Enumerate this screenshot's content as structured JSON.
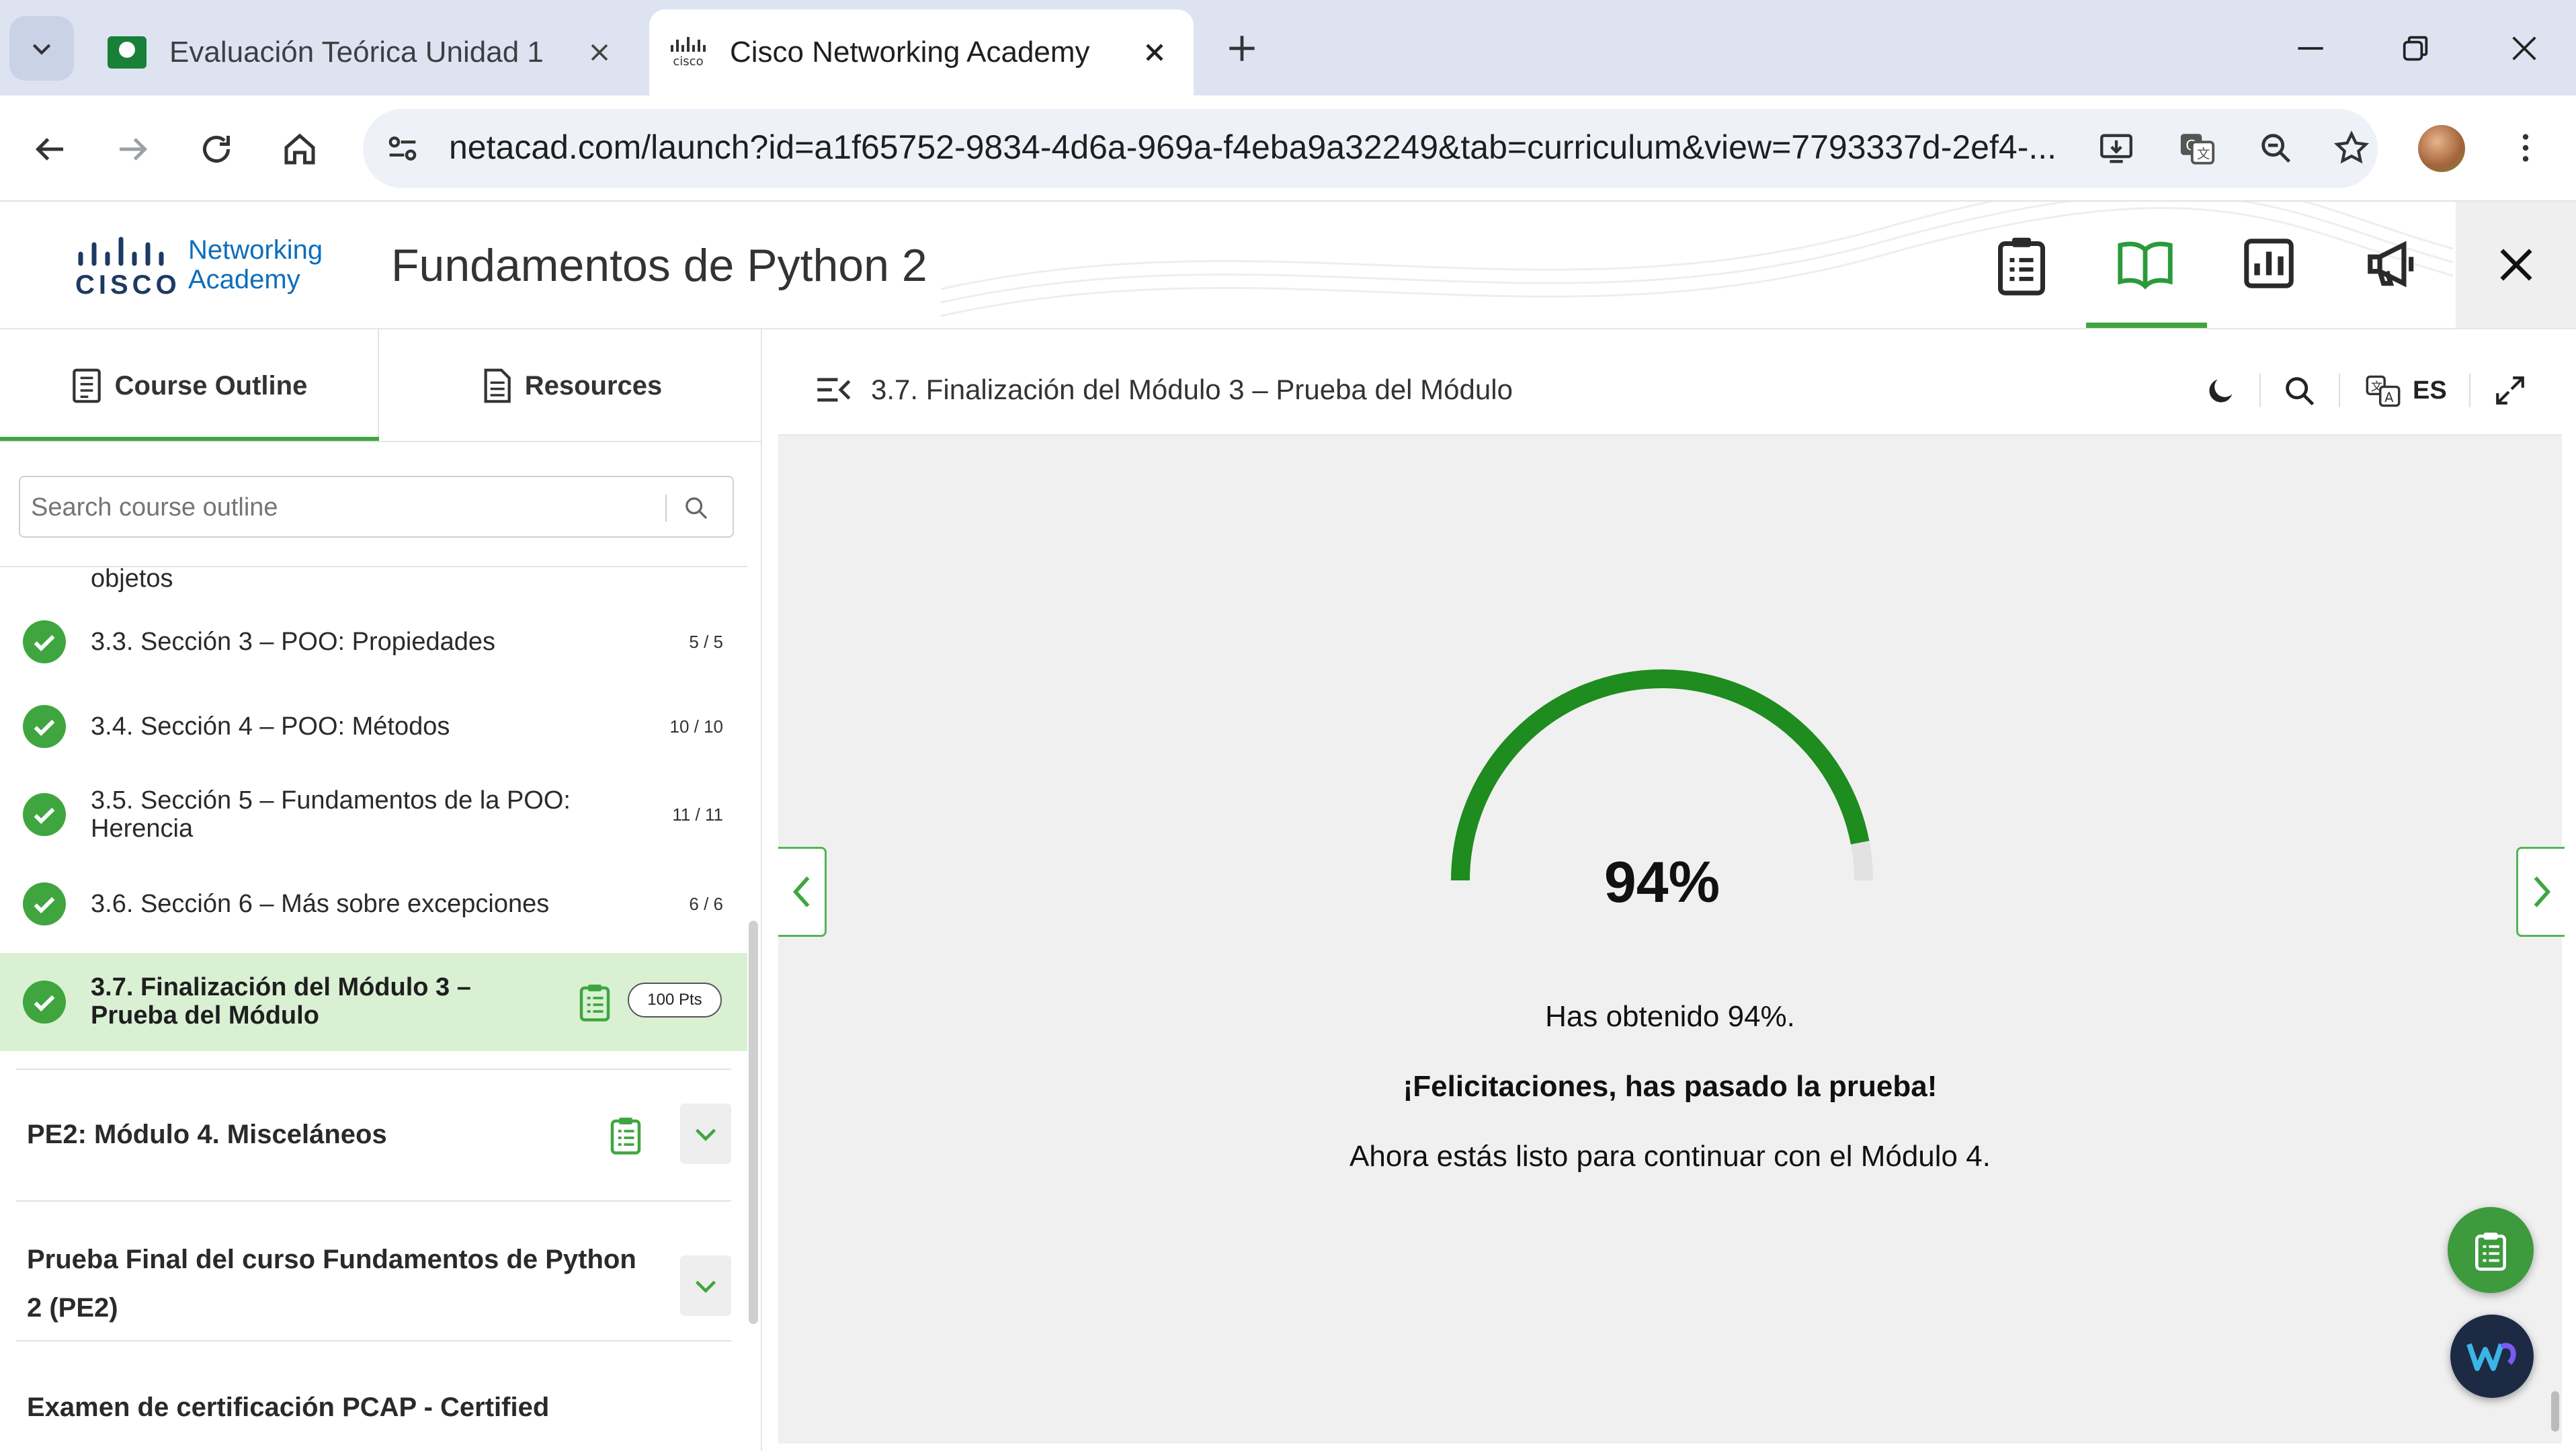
{
  "browser": {
    "tabs": [
      {
        "title": "Evaluación Teórica Unidad 1",
        "active": false
      },
      {
        "title": "Cisco Networking Academy",
        "active": true
      }
    ],
    "url": "netacad.com/launch?id=a1f65752-9834-4d6a-969a-f4eba9a32249&tab=curriculum&view=7793337d-2ef4-..."
  },
  "app": {
    "logo_line1": "Networking",
    "logo_line2": "Academy",
    "cisco_word": "CISCO",
    "course_title": "Fundamentos de Python 2"
  },
  "sidebar": {
    "tab_outline": "Course Outline",
    "tab_resources": "Resources",
    "search_placeholder": "Search course outline",
    "partial_top": "objetos",
    "items": [
      {
        "label": "3.3. Sección 3 – POO: Propiedades",
        "count": "5 / 5"
      },
      {
        "label": "3.4. Sección 4 – POO: Métodos",
        "count": "10 / 10"
      },
      {
        "label_l1": "3.5. Sección 5 – Fundamentos de la POO:",
        "label_l2": "Herencia",
        "count": "11 / 11"
      },
      {
        "label": "3.6. Sección 6 – Más sobre excepciones",
        "count": "6 / 6"
      },
      {
        "label_l1": "3.7. Finalización del Módulo 3 –",
        "label_l2": "Prueba del Módulo",
        "badge": "100 Pts"
      }
    ],
    "modules": [
      {
        "title": "PE2: Módulo 4. Misceláneos"
      },
      {
        "title_l1": "Prueba Final del curso Fundamentos de Python",
        "title_l2": "2 (PE2)"
      },
      {
        "title": "Examen de certificación PCAP - Certified"
      }
    ]
  },
  "main": {
    "header_title": "3.7. Finalización del Módulo 3 – Prueba del Módulo",
    "lang": "ES",
    "score_percent": 94,
    "score_label": "94%",
    "msg1": "Has obtenido 94%.",
    "msg2": "¡Felicitaciones, has pasado la prueba!",
    "msg3": "Ahora estás listo para continuar con el Módulo 4."
  },
  "colors": {
    "accent": "#4caf50",
    "gauge": "#1e8c1e",
    "active_item_bg": "#d9f0d3"
  }
}
